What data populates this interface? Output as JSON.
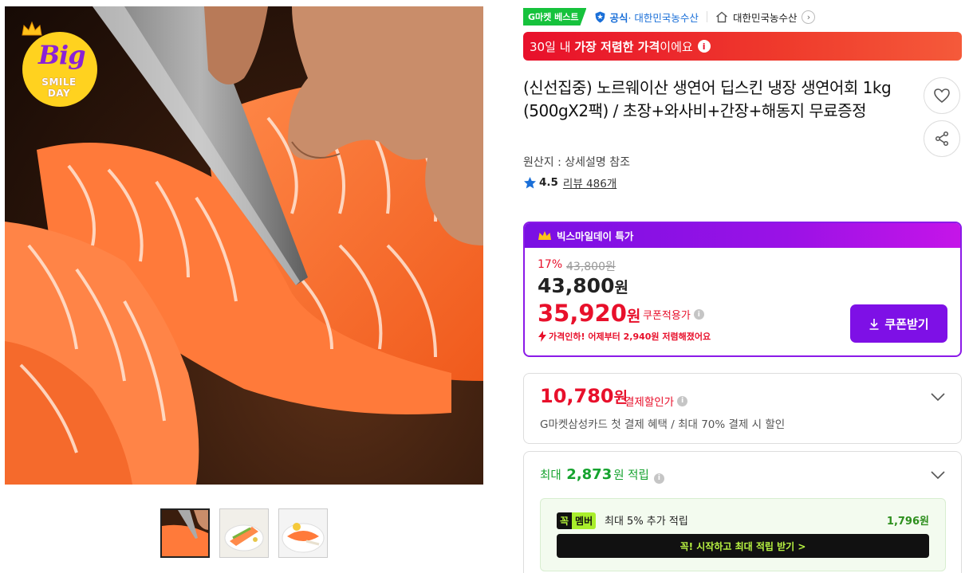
{
  "badge": {
    "big": "Big",
    "smile": "SMILE",
    "day": "DAY"
  },
  "meta": {
    "gmarket_best": "G마켓 베스트",
    "official_prefix": "공식",
    "official_seller": "· 대한민국농수산",
    "store_name": "대한민국농수산"
  },
  "lowest_banner": {
    "pre": "30일 내 ",
    "bold": "가장 저렴한 가격",
    "post": "이에요"
  },
  "product": {
    "title": "(신선집중) 노르웨이산 생연어 딥스킨 냉장 생연어회 1kg (500gX2팩) / 초장+와사비+간장+해동지 무료증정",
    "origin": "원산지 : 상세설명 참조",
    "rating": "4.5",
    "review_label": "리뷰 486개"
  },
  "deal": {
    "header": "빅스마일데이 특가",
    "discount_pct": "17%",
    "original_price": "43,800원",
    "price_num": "43,800",
    "price_unit": "원",
    "coupon_price_num": "35,920",
    "coupon_price_unit": "원",
    "coupon_label": "쿠폰적용가",
    "price_drop_msg": "가격인하! 어제부터 2,940원 저렴해졌어요",
    "coupon_button": "쿠폰받기"
  },
  "pay_discount": {
    "price_num": "10,780",
    "price_unit": "원",
    "label": "결제할인가",
    "description": "G마켓삼성카드 첫 결제 혜택 / 최대 70% 결제 시 할인"
  },
  "reward": {
    "prefix": "최대 ",
    "amount": "2,873",
    "suffix": "원 적립",
    "member_kkok": "꼭",
    "member_label": "멤버",
    "member_text": "최대 5% 추가 적립",
    "member_amount": "1,796원",
    "member_button": "꼭! 시작하고 최대 적립 받기 >"
  },
  "colors": {
    "deal_purple": "#7e10e6",
    "price_red": "#e8102b",
    "reward_green": "#16a32f"
  }
}
